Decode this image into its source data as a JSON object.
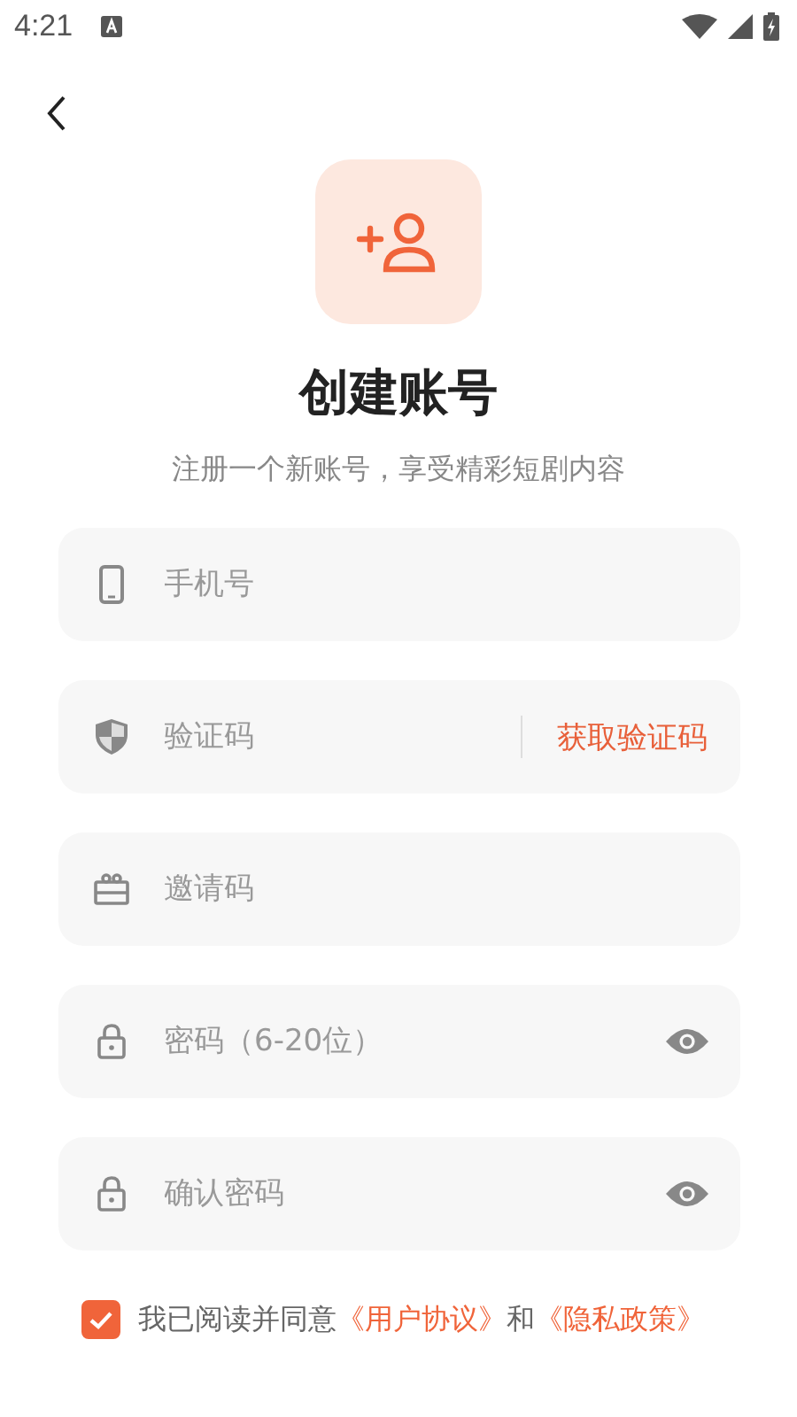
{
  "status_bar": {
    "time": "4:21"
  },
  "title": "创建账号",
  "subtitle": "注册一个新账号，享受精彩短剧内容",
  "fields": [
    {
      "kind": "phone",
      "placeholder": "手机号"
    },
    {
      "kind": "code",
      "placeholder": "验证码",
      "action": "获取验证码"
    },
    {
      "kind": "invite",
      "placeholder": "邀请码"
    },
    {
      "kind": "password",
      "placeholder": "密码（6-20位）"
    },
    {
      "kind": "password",
      "placeholder": "确认密码"
    }
  ],
  "agreement": {
    "checked": true,
    "text": "我已阅读并同意",
    "link_1": "《用户协议》",
    "conjunction": "和",
    "link_2": "《隐私政策》"
  }
}
